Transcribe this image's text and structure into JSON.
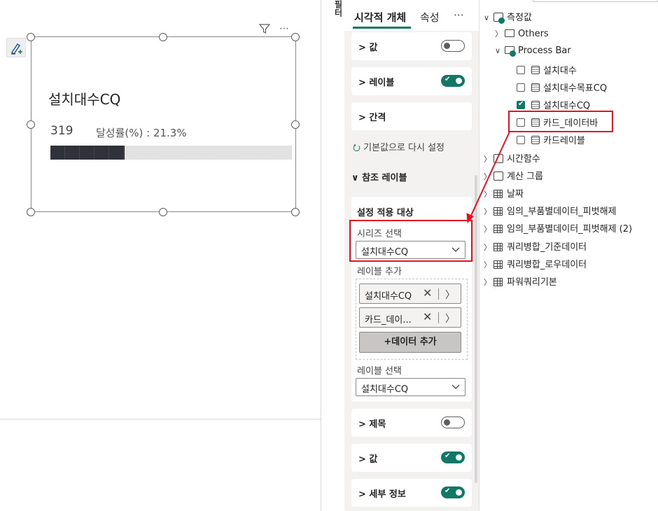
{
  "card_visual": {
    "title": "설치대수CQ",
    "value": "319",
    "rate_text": "달성률(%) : 21.3%",
    "progress_fraction": 0.306,
    "menu_filter_icon": "filter-icon",
    "menu_more": "⋯"
  },
  "filters_strip_label": "필터",
  "format_pane": {
    "tabs": [
      "시각적 개체",
      "속성"
    ],
    "more": "⋯",
    "cards_top": [
      {
        "label": "값",
        "toggle": "off"
      },
      {
        "label": "레이블",
        "toggle": "on"
      },
      {
        "label": "간격",
        "toggle": null
      }
    ],
    "reset_label": "기본값으로 다시 설정",
    "section_title": "참조 레이블",
    "settings": {
      "title": "설정 적용 대상",
      "series_label": "시리즈 선택",
      "series_value": "설치대수CQ",
      "add_label": "레이블 추가",
      "label_items": [
        "설치대수CQ",
        "카드_데이..."
      ],
      "add_data_button": "+데이터 추가",
      "label_select_label": "레이블 선택",
      "label_select_value": "설치대수CQ"
    },
    "cards_bottom": [
      {
        "label": "제목",
        "toggle": "off"
      },
      {
        "label": "값",
        "toggle": "on"
      },
      {
        "label": "세부 정보",
        "toggle": "on"
      }
    ]
  },
  "data_pane": {
    "root": "측정값",
    "others": "Others",
    "process_bar": "Process Bar",
    "fields": [
      {
        "name": "설치대수",
        "checked": false
      },
      {
        "name": "설치대수목표CQ",
        "checked": false
      },
      {
        "name": "설치대수CQ",
        "checked": true
      },
      {
        "name": "카드_데이터바",
        "checked": false
      },
      {
        "name": "카드레이블",
        "checked": false
      }
    ],
    "groups": [
      "시간함수",
      "계산 그룹",
      "날짜"
    ],
    "tables": [
      "임의_부품별데이터_피벗해제",
      "임의_부품별데이터_피벗해제 (2)",
      "쿼리병합_기준데이터",
      "쿼리병합_로우데이터",
      "파워쿼리기본"
    ]
  },
  "colors": {
    "accent": "#117865",
    "highlight": "#e81123"
  }
}
